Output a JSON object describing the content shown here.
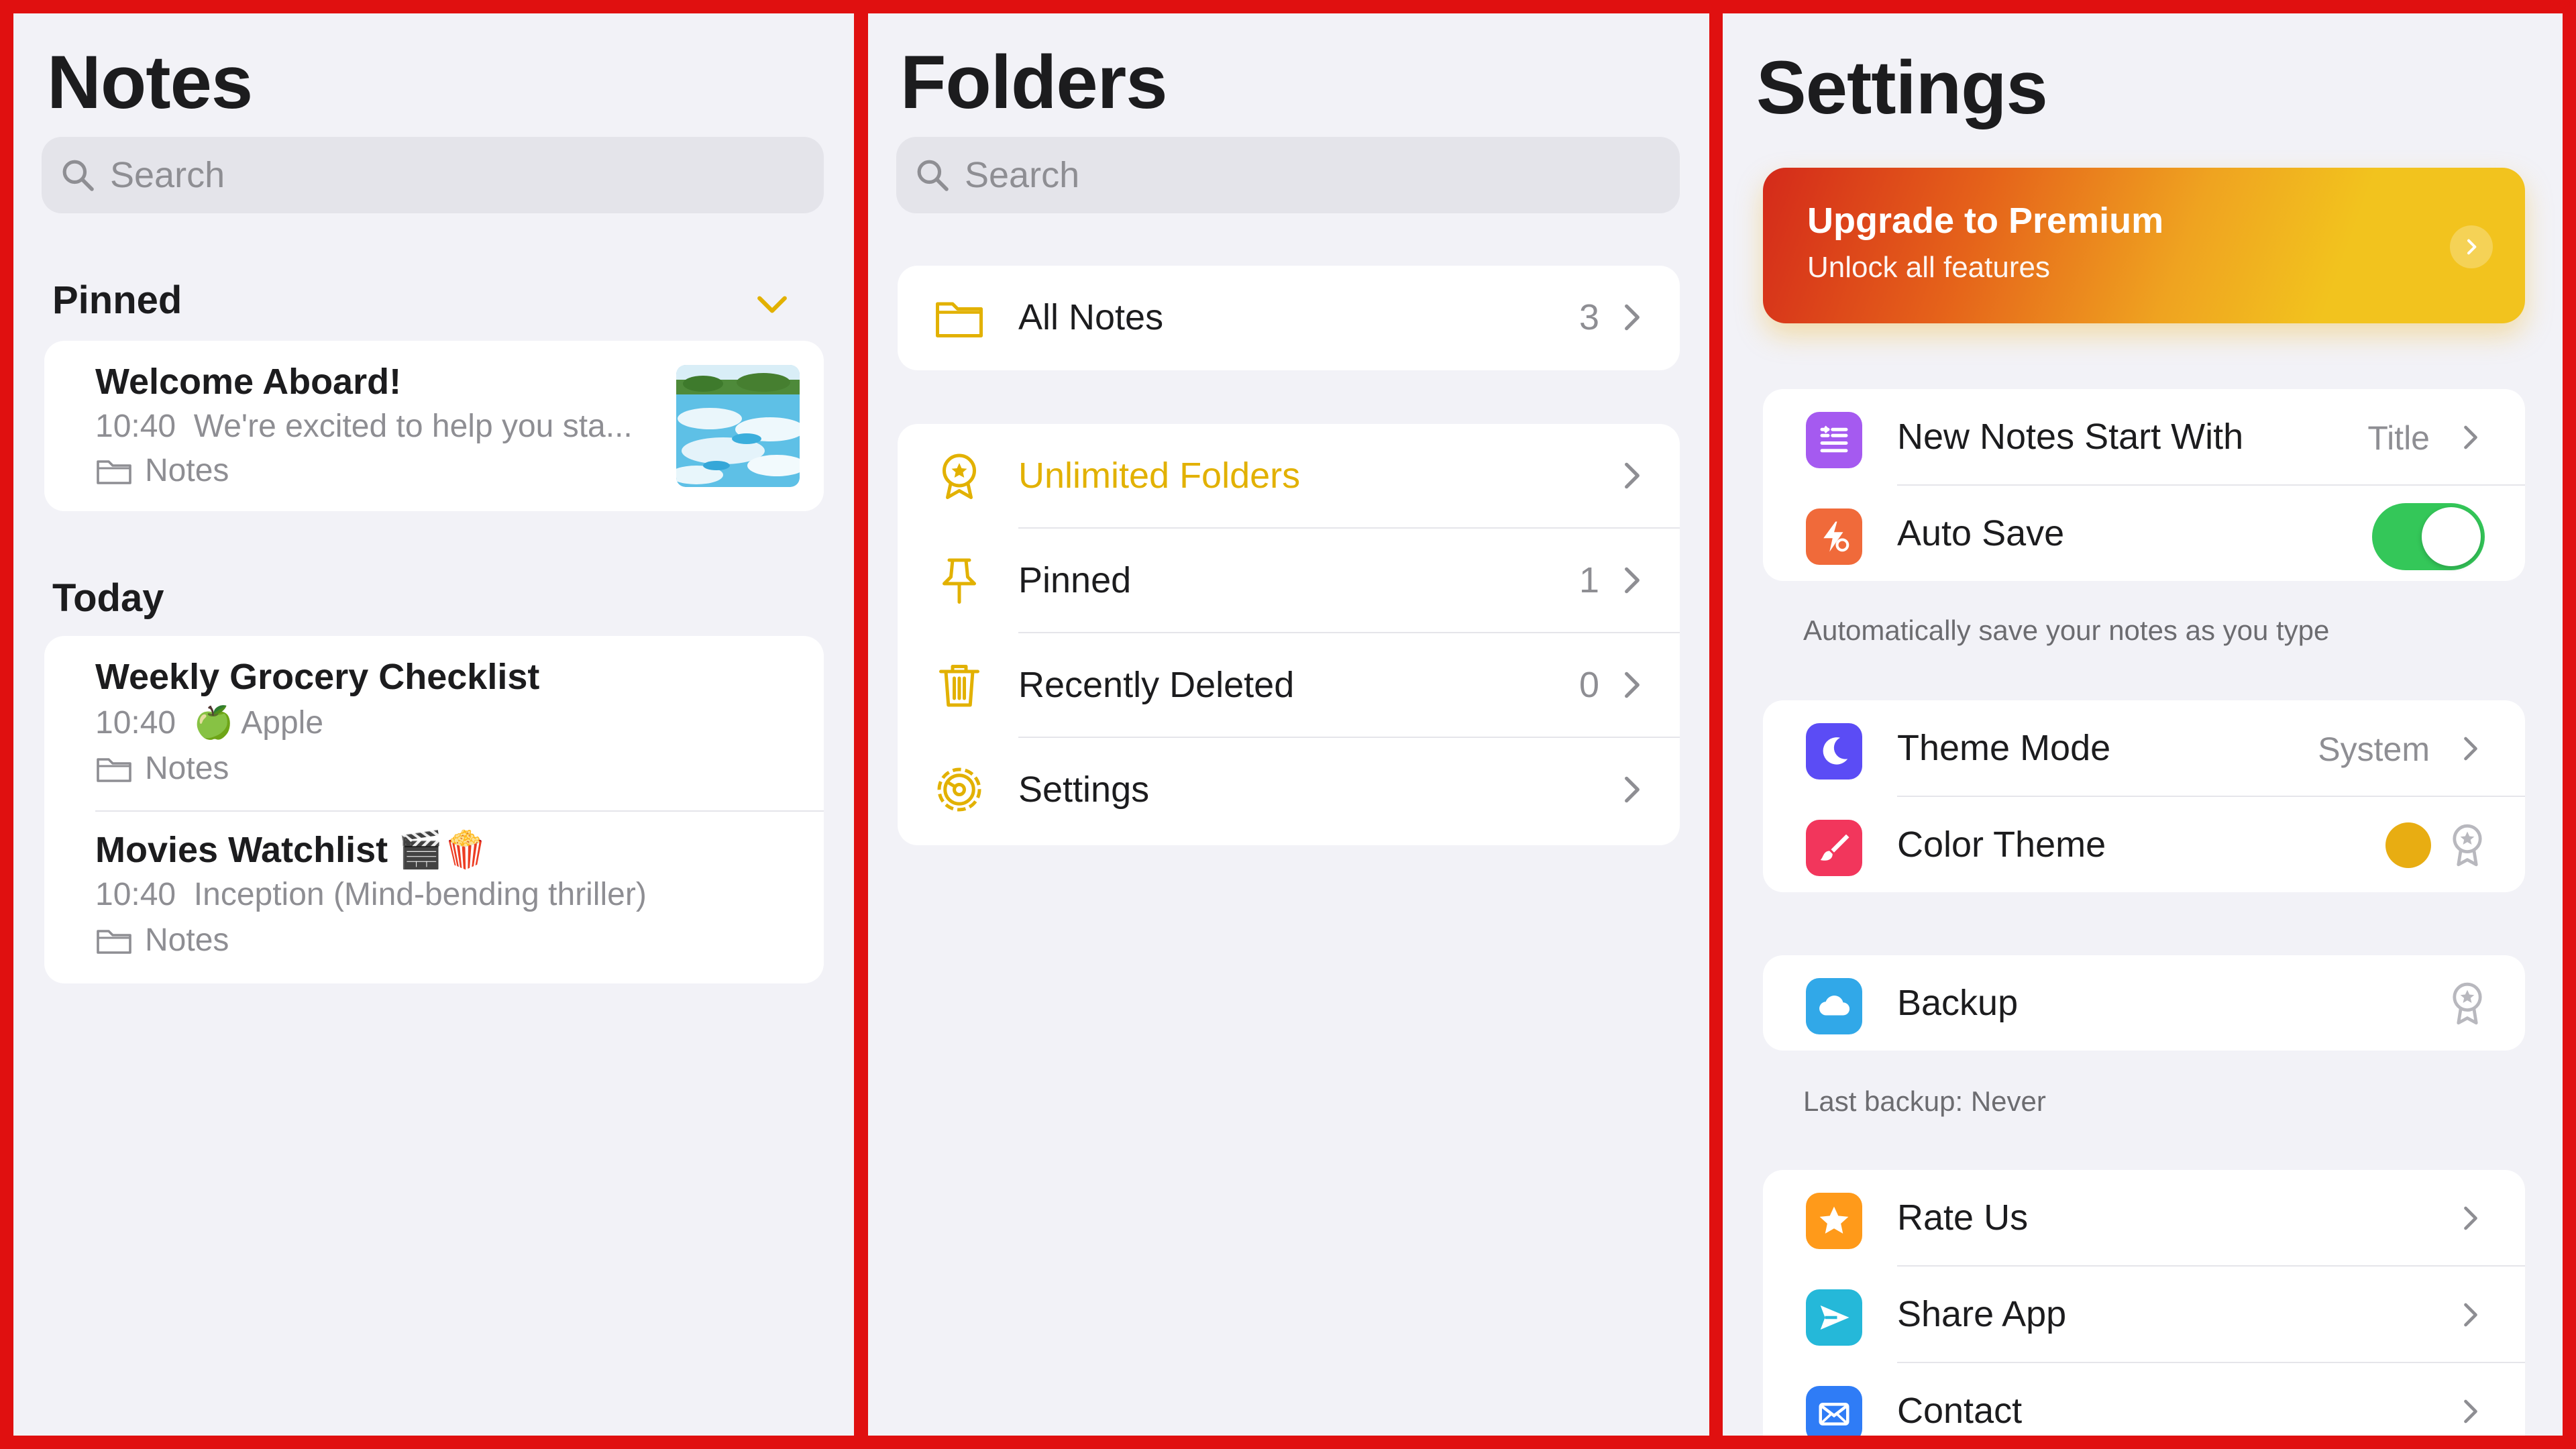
{
  "notes_panel": {
    "title": "Notes",
    "search_placeholder": "Search",
    "pinned_label": "Pinned",
    "today_label": "Today",
    "pinned_notes": [
      {
        "title": "Welcome Aboard!",
        "time": "10:40",
        "preview": "We're excited to help you sta...",
        "folder": "Notes",
        "has_thumbnail": true
      }
    ],
    "today_notes": [
      {
        "title": "Weekly Grocery Checklist",
        "time": "10:40",
        "preview": "🍏 Apple",
        "folder": "Notes"
      },
      {
        "title": "Movies Watchlist 🎬🍿",
        "time": "10:40",
        "preview": "Inception (Mind-bending thriller)",
        "folder": "Notes"
      }
    ]
  },
  "folders_panel": {
    "title": "Folders",
    "search_placeholder": "Search",
    "all_notes": {
      "label": "All Notes",
      "count": "3"
    },
    "items": [
      {
        "label": "Unlimited Folders",
        "count": "",
        "highlight": true,
        "icon": "award-icon"
      },
      {
        "label": "Pinned",
        "count": "1",
        "icon": "pin-icon"
      },
      {
        "label": "Recently Deleted",
        "count": "0",
        "icon": "trash-icon"
      },
      {
        "label": "Settings",
        "count": "",
        "icon": "gear-icon"
      }
    ],
    "accent": "#E2B100"
  },
  "settings_panel": {
    "title": "Settings",
    "premium": {
      "title": "Upgrade to Premium",
      "subtitle": "Unlock all features"
    },
    "group1": [
      {
        "label": "New Notes Start With",
        "value": "Title",
        "icon": "list-icon",
        "icon_bg": "#A55AF0"
      },
      {
        "label": "Auto Save",
        "toggle": true,
        "icon": "bolt-icon",
        "icon_bg": "#F06A3A"
      }
    ],
    "group1_caption": "Automatically save your notes as you type",
    "group2": [
      {
        "label": "Theme Mode",
        "value": "System",
        "icon": "moon-icon",
        "icon_bg": "#5B4CF5"
      },
      {
        "label": "Color Theme",
        "icon": "brush-icon",
        "icon_bg": "#F2365C",
        "color": "#E8AD12"
      }
    ],
    "group3": [
      {
        "label": "Backup",
        "icon": "cloud-icon",
        "icon_bg": "#31A8E8"
      }
    ],
    "group3_caption": "Last backup: Never",
    "group4": [
      {
        "label": "Rate Us",
        "icon": "star-icon",
        "icon_bg": "#FF9A1A"
      },
      {
        "label": "Share App",
        "icon": "send-icon",
        "icon_bg": "#25B8D9"
      },
      {
        "label": "Contact",
        "icon": "mail-icon",
        "icon_bg": "#2F7CF6"
      }
    ]
  }
}
